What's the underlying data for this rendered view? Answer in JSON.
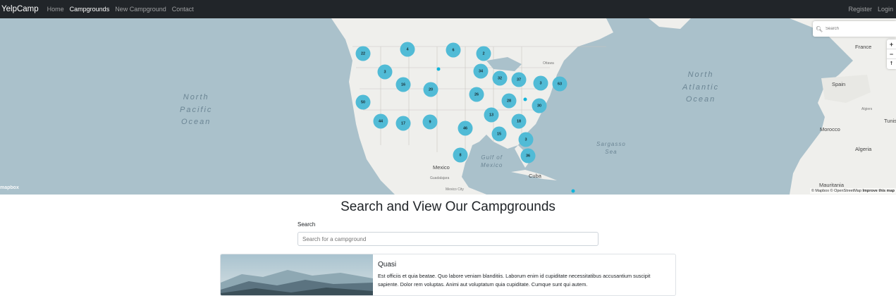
{
  "navbar": {
    "brand": "YelpCamp",
    "links": [
      "Home",
      "Campgrounds",
      "New Campground",
      "Contact"
    ],
    "active": "Campgrounds",
    "right_links": [
      "Register",
      "Login"
    ]
  },
  "map": {
    "oceans": {
      "north_pacific": "North\nPacific\nOcean",
      "north_atlantic": "North\nAtlantic\nOcean",
      "gulf": "Gulf of\nMexico",
      "sargasso": "Sargasso\nSea"
    },
    "places": {
      "france": "France",
      "spain": "Spain",
      "morocco": "Morocco",
      "algeria": "Algeria",
      "algiers": "Algiers",
      "tunis": "Tunis",
      "mauritania": "Mauritania",
      "mexico": "Mexico",
      "cuba": "Cuba",
      "ottawa": "Ottawa",
      "mexico_city": "Mexico City",
      "guadalajara": "Guadalajara"
    },
    "clusters": [
      "22",
      "4",
      "6",
      "2",
      "3",
      "34",
      "32",
      "37",
      "3",
      "63",
      "16",
      "20",
      "26",
      "28",
      "30",
      "50",
      "13",
      "18",
      "44",
      "17",
      "9",
      "46",
      "15",
      "3",
      "8",
      "36"
    ],
    "geocoder_placeholder": "Search",
    "controls": [
      "+",
      "−",
      "⭡"
    ],
    "logo": "mapbox",
    "attribution": "© Mapbox © OpenStreetMap",
    "attribution_link": "Improve this map"
  },
  "main": {
    "heading": "Search and View Our Campgrounds",
    "search_label": "Search",
    "search_placeholder": "Search for a campground"
  },
  "card": {
    "title": "Quasi",
    "text": "Est officiis et quia beatae. Quo labore veniam blanditiis. Laborum enim id cupiditate necessitatibus accusantium suscipit sapiente. Dolor rem voluptas. Animi aut voluptatum quia cupiditate. Cumque sunt qui autem."
  },
  "colors": {
    "navbar": "#212529",
    "water": "#aac1cb",
    "land": "#efefec",
    "cluster": "#51bbd6",
    "point": "#11b4da"
  }
}
